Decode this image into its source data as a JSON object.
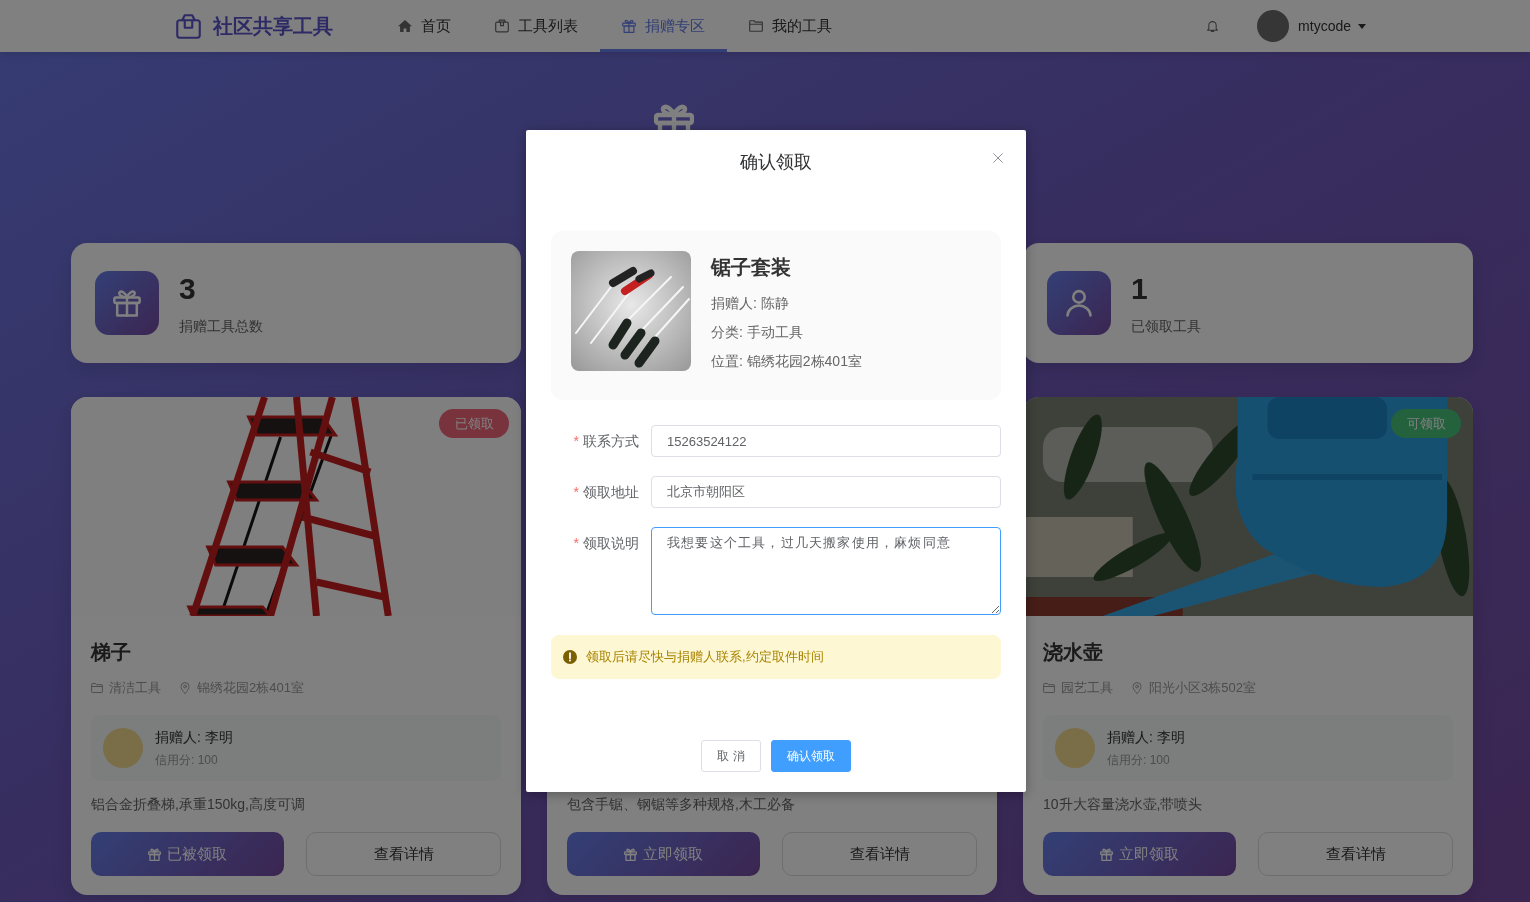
{
  "header": {
    "logo": "社区共享工具",
    "nav": [
      {
        "label": "首页",
        "selected": false
      },
      {
        "label": "工具列表",
        "selected": false
      },
      {
        "label": "捐赠专区",
        "selected": true
      },
      {
        "label": "我的工具",
        "selected": false
      }
    ],
    "user": {
      "name": "mtycode"
    }
  },
  "stats": [
    {
      "value": "3",
      "label": "捐赠工具总数"
    },
    {
      "value": "1",
      "label": "已领取工具"
    }
  ],
  "tools": [
    {
      "claimed": true,
      "status": "已领取",
      "name": "梯子",
      "category": "清洁工具",
      "location": "锦绣花园2栋401室",
      "donor": "捐赠人: 李明",
      "credit": "信用分: 100",
      "description": "铝合金折叠梯,承重150kg,高度可调",
      "claim_button": "已被领取",
      "detail_button": "查看详情"
    },
    {
      "description": "包含手锯、钢锯等多种规格,木工必备",
      "claim_button": "立即领取",
      "detail_button": "查看详情"
    },
    {
      "claimed": false,
      "status": "可领取",
      "name": "浇水壶",
      "category": "园艺工具",
      "location": "阳光小区3栋502室",
      "donor": "捐赠人: 李明",
      "credit": "信用分: 100",
      "description": "10升大容量浇水壶,带喷头",
      "claim_button": "立即领取",
      "detail_button": "查看详情"
    }
  ],
  "dialog": {
    "title": "确认领取",
    "tool": {
      "name": "锯子套装",
      "details": [
        "捐赠人: 陈静",
        "分类: 手动工具",
        "位置: 锦绣花园2栋401室"
      ]
    },
    "fields": [
      {
        "kind": "input",
        "marker": "*",
        "label": "联系方式",
        "value": "15263524122",
        "focused": false
      },
      {
        "kind": "input",
        "marker": "*",
        "label": "领取地址",
        "value": "北京市朝阳区",
        "focused": false
      },
      {
        "kind": "textarea",
        "marker": "*",
        "label": "领取说明",
        "value": "我想要这个工具，过几天搬家使用，麻烦同意",
        "focused": true
      }
    ],
    "notice": "领取后请尽快与捐赠人联系,约定取件时间",
    "buttons": [
      {
        "kind": "default",
        "label": "取 消"
      },
      {
        "kind": "primary",
        "label": "确认领取"
      }
    ]
  }
}
